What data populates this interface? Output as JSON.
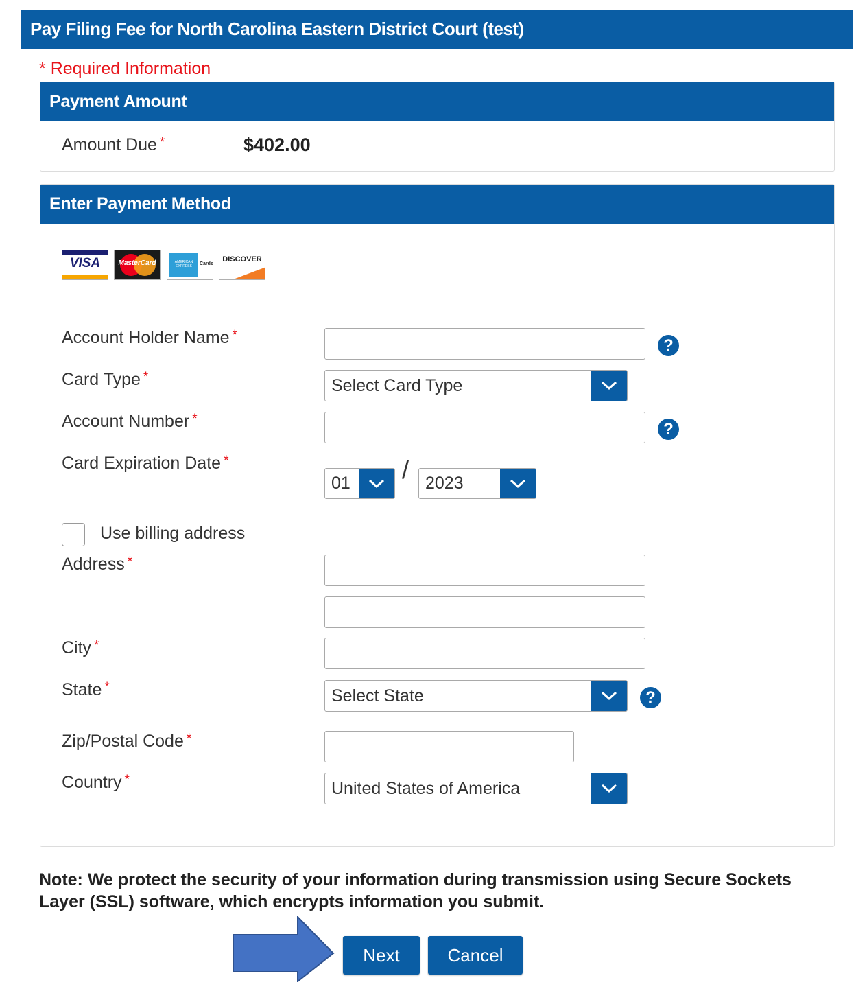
{
  "header": {
    "title": "Pay Filing Fee for North Carolina Eastern District Court (test)"
  },
  "required_info": {
    "star": "*",
    "text": "Required Information"
  },
  "payment_amount": {
    "heading": "Payment Amount",
    "amount_due_label": "Amount Due",
    "amount_due_value": "$402.00"
  },
  "payment_method": {
    "heading": "Enter Payment Method",
    "cards": [
      {
        "name": "VISA"
      },
      {
        "name": "MasterCard"
      },
      {
        "name": "AMERICAN EXPRESS"
      },
      {
        "name": "DISCOVER"
      }
    ],
    "fields": {
      "account_holder_label": "Account Holder Name",
      "card_type_label": "Card Type",
      "card_type_value": "Select Card Type",
      "account_number_label": "Account Number",
      "expiration_label": "Card Expiration Date",
      "exp_month_value": "01",
      "exp_separator": "/",
      "exp_year_value": "2023",
      "use_billing_label": "Use billing address",
      "address_label": "Address",
      "city_label": "City",
      "state_label": "State",
      "state_value": "Select State",
      "zip_label": "Zip/Postal Code",
      "country_label": "Country",
      "country_value": "United States of America"
    },
    "help_symbol": "?",
    "required_star": "*"
  },
  "note": "Note: We protect the security of your information during transmission using Secure Sockets Layer (SSL) software, which encrypts information you submit.",
  "buttons": {
    "next": "Next",
    "cancel": "Cancel"
  },
  "colors": {
    "primary": "#0a5da4",
    "required": "#e8141b",
    "arrow": "#4472c4"
  }
}
